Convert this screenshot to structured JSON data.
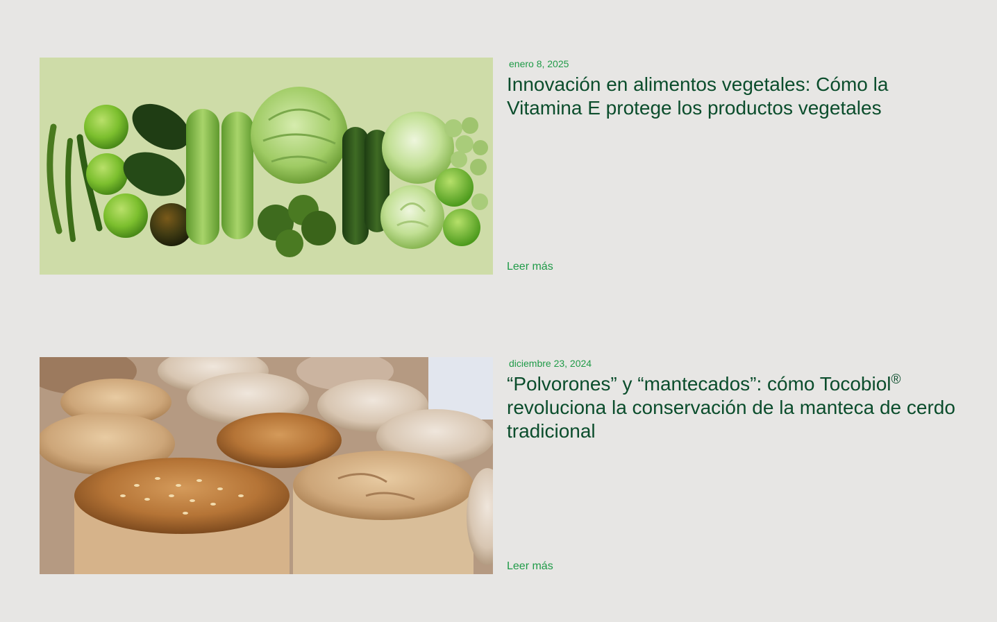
{
  "posts": [
    {
      "date": "enero 8, 2025",
      "title": "Innovación en alimentos vegetales: Cómo la Vitamina E protege los productos vegetales",
      "read_more": "Leer más",
      "image": "green-vegetables-photo"
    },
    {
      "date": "diciembre 23, 2024",
      "title_before": "“Polvorones” y “mantecados”: cómo Tocobiol",
      "title_sup": "®",
      "title_after": " revoluciona la conservación de la manteca de cerdo tradicional",
      "read_more": "Leer más",
      "image": "polvorones-photo"
    }
  ],
  "colors": {
    "background": "#e7e6e4",
    "title": "#0b4d2c",
    "accent": "#1f9a47"
  }
}
